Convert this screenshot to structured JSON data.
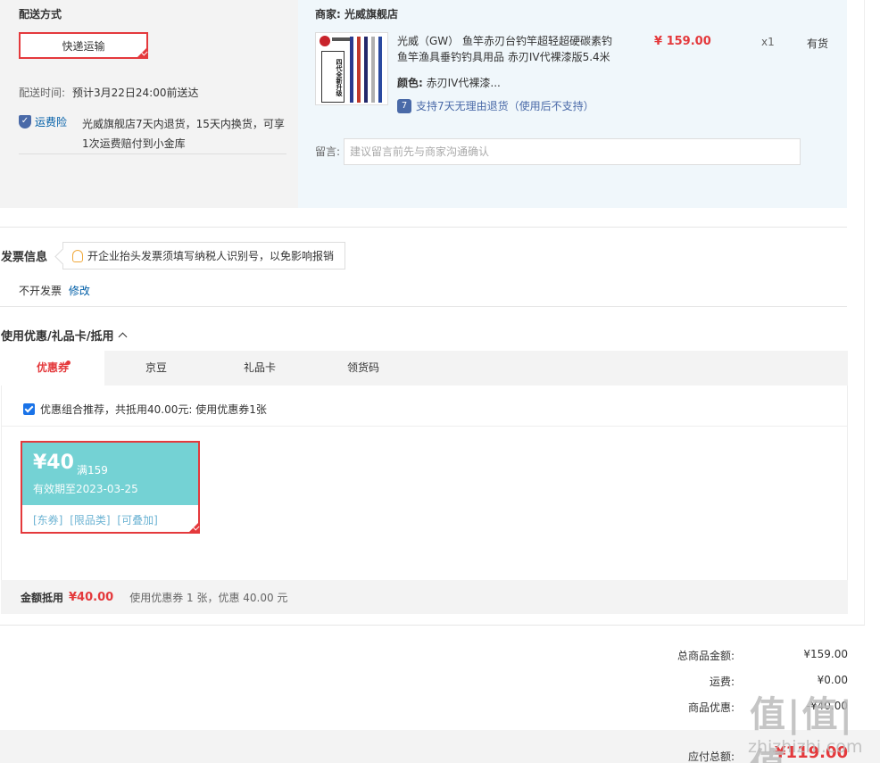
{
  "shipping": {
    "title": "配送方式",
    "method": "快递运输",
    "time_label": "配送时间:",
    "time_value": "预计3月22日24:00前送达",
    "insurance_label": "运费险",
    "insurance_desc_line1": "光威旗舰店7天内退货，15天内换货，可享",
    "insurance_desc_line2": "1次运费赔付到小金库"
  },
  "merchant": {
    "label": "商家:",
    "name": "光威旗舰店",
    "product_title_line1": "光威（GW） 鱼竿赤刃台钓竿超轻超硬碳素钓",
    "product_title_line2": "鱼竿渔具垂钓钓具用品 赤刃IV代裸漆版5.4米",
    "price": "¥ 159.00",
    "quantity": "x1",
    "stock": "有货",
    "color_label": "颜色:",
    "color_value": "赤刃IV代裸漆...",
    "return_policy": "支持7天无理由退货（使用后不支持）",
    "remark_label": "留言:",
    "remark_placeholder": "建议留言前先与商家沟通确认",
    "thumb_text": "四代全新升级"
  },
  "invoice": {
    "title": "发票信息",
    "tip": "开企业抬头发票须填写纳税人识别号，以免影响报销",
    "status": "不开发票",
    "edit": "修改"
  },
  "discount": {
    "title": "使用优惠/礼品卡/抵用",
    "tabs": [
      {
        "label": "优惠券"
      },
      {
        "label": "京豆"
      },
      {
        "label": "礼品卡"
      },
      {
        "label": "领货码"
      }
    ],
    "recommend_text": "优惠组合推荐，共抵用40.00元: 使用优惠券1张",
    "coupon": {
      "amount": "¥40",
      "condition": "满159",
      "validity": "有效期至2023-03-25",
      "tags": [
        "[东券]",
        "[限品类]",
        "[可叠加]"
      ]
    },
    "summary_label": "金额抵用",
    "summary_amount": "¥40.00",
    "summary_desc": "使用优惠券 1 张，优惠 40.00 元"
  },
  "totals": {
    "goods_label": "总商品金额:",
    "goods_value": "¥159.00",
    "freight_label": "运费:",
    "freight_value": "¥0.00",
    "discount_label": "商品优惠:",
    "discount_value": "-¥40.00",
    "payable_label": "应付总额:",
    "payable_value": "¥119.00"
  },
  "colors": {
    "accent_red": "#e4393c",
    "coupon_teal": "#74d2d4",
    "link_blue": "#005ea7"
  },
  "watermark": {
    "logo": "值|值|值",
    "site": "zhizhizhi.com"
  }
}
